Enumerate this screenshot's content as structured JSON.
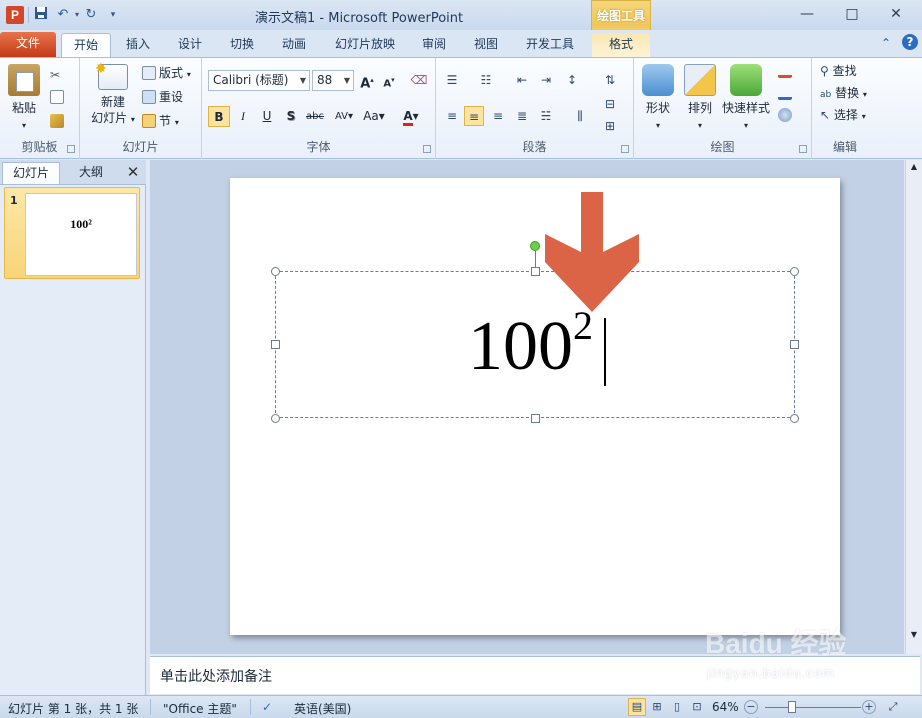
{
  "window": {
    "title": "演示文稿1  -  Microsoft PowerPoint",
    "contextual_tab_group": "绘图工具",
    "controls": {
      "minimize": "—",
      "maximize": "□",
      "close": "✕"
    }
  },
  "quick_access": {
    "save_icon": "save-icon",
    "undo_icon": "undo-icon",
    "redo_icon": "redo-icon"
  },
  "tabs": [
    "文件",
    "开始",
    "插入",
    "设计",
    "切换",
    "动画",
    "幻灯片放映",
    "审阅",
    "视图",
    "开发工具",
    "格式"
  ],
  "active_tab": "开始",
  "ribbon": {
    "clipboard": {
      "label": "剪贴板",
      "paste": "粘贴"
    },
    "slides": {
      "label": "幻灯片",
      "new_slide": "新建",
      "new_slide2": "幻灯片",
      "layout": "版式",
      "reset": "重设",
      "section": "节"
    },
    "font": {
      "label": "字体",
      "font_name": "Calibri (标题)",
      "font_size": "88",
      "bold": "B",
      "italic": "I",
      "underline": "U",
      "shadow": "S",
      "strike": "abc",
      "spacing": "AV",
      "case": "Aa",
      "color": "A",
      "grow": "A",
      "shrink": "A"
    },
    "paragraph": {
      "label": "段落"
    },
    "drawing": {
      "label": "绘图",
      "shapes": "形状",
      "arrange": "排列",
      "quick_styles": "快速样式"
    },
    "editing": {
      "label": "编辑",
      "find": "查找",
      "replace": "替换",
      "select": "选择"
    }
  },
  "left_pane": {
    "tab_slides": "幻灯片",
    "tab_outline": "大纲",
    "close": "✕",
    "slide_number": "1",
    "thumb_base": "100",
    "thumb_exp": "²"
  },
  "slide": {
    "base": "100",
    "exponent": "2"
  },
  "notes": {
    "placeholder": "单击此处添加备注"
  },
  "status": {
    "slide_info": "幻灯片 第 1 张，共 1 张",
    "theme": "\"Office 主题\"",
    "language": "英语(美国)",
    "zoom": "64%",
    "zoom_level_percent": 64
  },
  "watermark": {
    "logo": "Baidu 经验",
    "url": "jingyan.baidu.com"
  },
  "colors": {
    "accent_file_tab": "#d24726",
    "arrow": "#dc6446",
    "contextual": "#f0c75a"
  }
}
